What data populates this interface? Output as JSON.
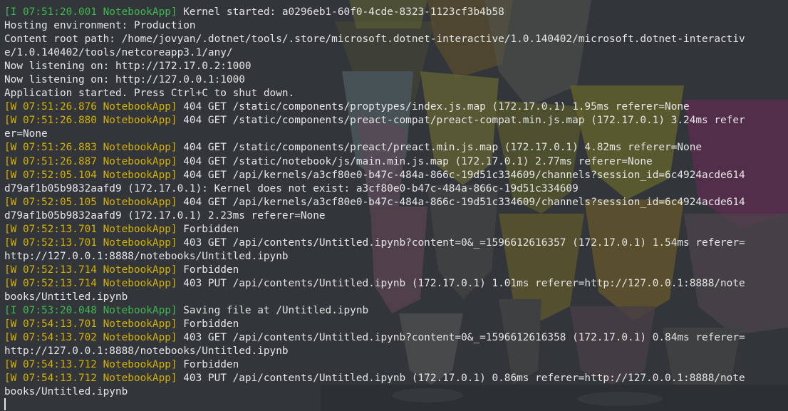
{
  "colors": {
    "background": "#323539",
    "text": "#e6e6e6",
    "info_prefix": "#3fb950",
    "warn_prefix": "#d4b106"
  },
  "lines": [
    {
      "prefix": "[I 07:51:20.001 NotebookApp]",
      "level": "I",
      "text": " Kernel started: a0296eb1-60f0-4cde-8323-1123cf3b4b58"
    },
    {
      "prefix": "",
      "level": "",
      "text": "Hosting environment: Production"
    },
    {
      "prefix": "",
      "level": "",
      "text": "Content root path: /home/jovyan/.dotnet/tools/.store/microsoft.dotnet-interactive/1.0.140402/microsoft.dotnet-interactiv"
    },
    {
      "prefix": "",
      "level": "",
      "text": "e/1.0.140402/tools/netcoreapp3.1/any/"
    },
    {
      "prefix": "",
      "level": "",
      "text": "Now listening on: http://172.17.0.2:1000"
    },
    {
      "prefix": "",
      "level": "",
      "text": "Now listening on: http://127.0.0.1:1000"
    },
    {
      "prefix": "",
      "level": "",
      "text": "Application started. Press Ctrl+C to shut down."
    },
    {
      "prefix": "[W 07:51:26.876 NotebookApp]",
      "level": "W",
      "text": " 404 GET /static/components/proptypes/index.js.map (172.17.0.1) 1.95ms referer=None"
    },
    {
      "prefix": "[W 07:51:26.880 NotebookApp]",
      "level": "W",
      "text": " 404 GET /static/components/preact-compat/preact-compat.min.js.map (172.17.0.1) 3.24ms refer"
    },
    {
      "prefix": "",
      "level": "",
      "text": "er=None"
    },
    {
      "prefix": "[W 07:51:26.883 NotebookApp]",
      "level": "W",
      "text": " 404 GET /static/components/preact/preact.min.js.map (172.17.0.1) 4.82ms referer=None"
    },
    {
      "prefix": "[W 07:51:26.887 NotebookApp]",
      "level": "W",
      "text": " 404 GET /static/notebook/js/main.min.js.map (172.17.0.1) 2.77ms referer=None"
    },
    {
      "prefix": "[W 07:52:05.104 NotebookApp]",
      "level": "W",
      "text": " 404 GET /api/kernels/a3cf80e0-b47c-484a-866c-19d51c334609/channels?session_id=6c4924acde614"
    },
    {
      "prefix": "",
      "level": "",
      "text": "d79af1b05b9832aafd9 (172.17.0.1): Kernel does not exist: a3cf80e0-b47c-484a-866c-19d51c334609"
    },
    {
      "prefix": "[W 07:52:05.105 NotebookApp]",
      "level": "W",
      "text": " 404 GET /api/kernels/a3cf80e0-b47c-484a-866c-19d51c334609/channels?session_id=6c4924acde614"
    },
    {
      "prefix": "",
      "level": "",
      "text": "d79af1b05b9832aafd9 (172.17.0.1) 2.23ms referer=None"
    },
    {
      "prefix": "[W 07:52:13.701 NotebookApp]",
      "level": "W",
      "text": " Forbidden"
    },
    {
      "prefix": "[W 07:52:13.701 NotebookApp]",
      "level": "W",
      "text": " 403 GET /api/contents/Untitled.ipynb?content=0&_=1596612616357 (172.17.0.1) 1.54ms referer="
    },
    {
      "prefix": "",
      "level": "",
      "text": "http://127.0.0.1:8888/notebooks/Untitled.ipynb"
    },
    {
      "prefix": "[W 07:52:13.714 NotebookApp]",
      "level": "W",
      "text": " Forbidden"
    },
    {
      "prefix": "[W 07:52:13.714 NotebookApp]",
      "level": "W",
      "text": " 403 PUT /api/contents/Untitled.ipynb (172.17.0.1) 1.01ms referer=http://127.0.0.1:8888/note"
    },
    {
      "prefix": "",
      "level": "",
      "text": "books/Untitled.ipynb"
    },
    {
      "prefix": "[I 07:53:20.048 NotebookApp]",
      "level": "I",
      "text": " Saving file at /Untitled.ipynb"
    },
    {
      "prefix": "[W 07:54:13.701 NotebookApp]",
      "level": "W",
      "text": " Forbidden"
    },
    {
      "prefix": "[W 07:54:13.702 NotebookApp]",
      "level": "W",
      "text": " 403 GET /api/contents/Untitled.ipynb?content=0&_=1596612616358 (172.17.0.1) 0.84ms referer="
    },
    {
      "prefix": "",
      "level": "",
      "text": "http://127.0.0.1:8888/notebooks/Untitled.ipynb"
    },
    {
      "prefix": "[W 07:54:13.712 NotebookApp]",
      "level": "W",
      "text": " Forbidden"
    },
    {
      "prefix": "[W 07:54:13.712 NotebookApp]",
      "level": "W",
      "text": " 403 PUT /api/contents/Untitled.ipynb (172.17.0.1) 0.86ms referer=http://127.0.0.1:8888/note"
    },
    {
      "prefix": "",
      "level": "",
      "text": "books/Untitled.ipynb"
    }
  ]
}
